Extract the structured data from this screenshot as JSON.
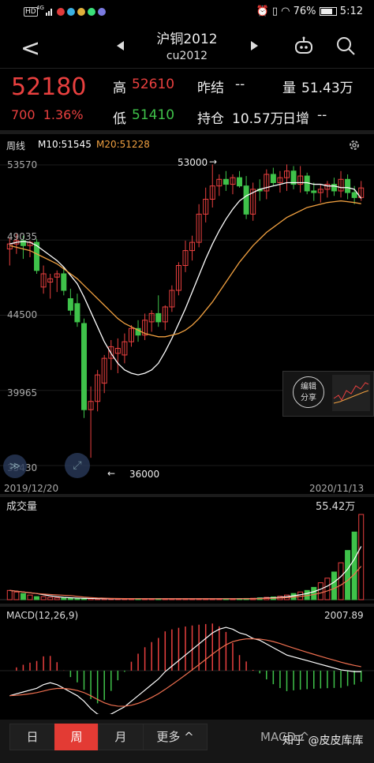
{
  "status": {
    "hd": "HD",
    "net": "4G",
    "time": "5:12",
    "battery": "76%"
  },
  "header": {
    "title": "沪铜2012",
    "subtitle": "cu2012"
  },
  "quote": {
    "price": "52180",
    "change": "700",
    "change_pct": "1.36%",
    "high_label": "高",
    "high": "52610",
    "low_label": "低",
    "low": "51410",
    "prev_settle_label": "昨结",
    "prev_settle": "--",
    "volume_label": "量",
    "volume": "51.43万",
    "open_interest_label": "持仓",
    "open_interest": "10.57万",
    "daily_add_label": "日增",
    "daily_add": "--"
  },
  "main_chart": {
    "period_label": "周线",
    "m10_label": "M10:51545",
    "m20_label": "M20:51228",
    "y_ticks": [
      "53570",
      "49035",
      "44500",
      "39965",
      "35430"
    ],
    "start_date": "2019/12/20",
    "end_date": "2020/11/13",
    "annotation_high": "53000",
    "annotation_low": "36000",
    "share_label_1": "编辑",
    "share_label_2": "分享"
  },
  "volume_chart": {
    "title": "成交量",
    "max": "55.42万"
  },
  "macd_chart": {
    "title": "MACD(12,26,9)",
    "max": "2007.89"
  },
  "tabs": [
    {
      "label": "日"
    },
    {
      "label": "周"
    },
    {
      "label": "月"
    },
    {
      "label": "更多"
    }
  ],
  "macd_button": "MACD",
  "watermark": "知乎 @皮皮库库",
  "colors": {
    "up": "#e9403f",
    "down": "#3fc24a",
    "m10": "#ffffff",
    "m20": "#f0a040"
  },
  "chart_data": {
    "type": "candlestick",
    "candles": [
      [
        48500,
        49200,
        47500,
        48800
      ],
      [
        48800,
        49400,
        48200,
        49000
      ],
      [
        49000,
        49300,
        47900,
        48700
      ],
      [
        48700,
        49000,
        48000,
        48900
      ],
      [
        48900,
        49100,
        47000,
        47200
      ],
      [
        46200,
        47500,
        45800,
        47000
      ],
      [
        46500,
        47000,
        45500,
        46700
      ],
      [
        46800,
        47200,
        45900,
        47000
      ],
      [
        47000,
        47400,
        45700,
        46000
      ],
      [
        45500,
        46100,
        44500,
        44800
      ],
      [
        45200,
        45800,
        43800,
        44100
      ],
      [
        44000,
        44300,
        38300,
        38800
      ],
      [
        38800,
        40200,
        35900,
        39300
      ],
      [
        39300,
        41200,
        38700,
        40900
      ],
      [
        40400,
        42100,
        39800,
        41900
      ],
      [
        41900,
        43000,
        41200,
        42600
      ],
      [
        42200,
        43100,
        41000,
        42500
      ],
      [
        42100,
        43400,
        41600,
        42900
      ],
      [
        42900,
        43900,
        42600,
        43700
      ],
      [
        43700,
        44200,
        42900,
        43300
      ],
      [
        43300,
        44600,
        43000,
        44200
      ],
      [
        44100,
        44800,
        43500,
        44600
      ],
      [
        44600,
        45700,
        43800,
        44100
      ],
      [
        44100,
        45100,
        43600,
        45000
      ],
      [
        45000,
        46300,
        44700,
        46000
      ],
      [
        46000,
        47700,
        45700,
        47500
      ],
      [
        47500,
        49000,
        47100,
        48400
      ],
      [
        48400,
        49300,
        47800,
        48900
      ],
      [
        48900,
        51200,
        48600,
        50600
      ],
      [
        50600,
        52200,
        50100,
        51500
      ],
      [
        51500,
        53600,
        51000,
        52300
      ],
      [
        52300,
        53000,
        51700,
        52700
      ],
      [
        52700,
        53200,
        52000,
        52400
      ],
      [
        52400,
        53000,
        51800,
        52800
      ],
      [
        52800,
        53200,
        52200,
        52300
      ],
      [
        52300,
        52900,
        50300,
        50600
      ],
      [
        50600,
        52500,
        50200,
        52100
      ],
      [
        52100,
        52700,
        51400,
        52000
      ],
      [
        52000,
        53300,
        51500,
        53000
      ],
      [
        53000,
        53400,
        52300,
        52500
      ],
      [
        52500,
        53200,
        51900,
        52800
      ],
      [
        52800,
        53600,
        52000,
        53200
      ],
      [
        53200,
        53500,
        52100,
        52400
      ],
      [
        52400,
        53500,
        51900,
        52900
      ],
      [
        52900,
        53100,
        51800,
        52000
      ],
      [
        52000,
        52500,
        51400,
        51900
      ],
      [
        51900,
        52400,
        51300,
        52100
      ],
      [
        52100,
        52600,
        51600,
        52400
      ],
      [
        52400,
        52800,
        51700,
        52000
      ],
      [
        52000,
        53200,
        51600,
        52700
      ],
      [
        52700,
        53000,
        51500,
        51900
      ],
      [
        51900,
        52300,
        51200,
        51600
      ],
      [
        51600,
        52600,
        51400,
        52180
      ]
    ],
    "ylim": [
      35430,
      53570
    ],
    "m10": [
      48800,
      48900,
      48950,
      48900,
      48700,
      48400,
      48100,
      47800,
      47400,
      46900,
      46400,
      45600,
      44700,
      43800,
      42900,
      42200,
      41600,
      41200,
      41000,
      40900,
      41000,
      41200,
      41600,
      42300,
      43100,
      44000,
      44900,
      45900,
      46900,
      47900,
      48800,
      49600,
      50300,
      50900,
      51400,
      51700,
      51900,
      52100,
      52200,
      52300,
      52400,
      52500,
      52500,
      52500,
      52500,
      52400,
      52400,
      52300,
      52300,
      52200,
      52200,
      52100,
      51545
    ],
    "m20": [
      48700,
      48600,
      48500,
      48400,
      48200,
      48000,
      47800,
      47600,
      47300,
      47000,
      46700,
      46300,
      45900,
      45500,
      45100,
      44700,
      44300,
      44000,
      43800,
      43600,
      43400,
      43300,
      43200,
      43200,
      43300,
      43400,
      43600,
      43900,
      44300,
      44800,
      45300,
      45900,
      46500,
      47100,
      47700,
      48200,
      48700,
      49100,
      49500,
      49800,
      50100,
      50400,
      50600,
      50800,
      51000,
      51100,
      51200,
      51300,
      51350,
      51400,
      51350,
      51300,
      51228
    ],
    "volume": [
      6,
      5,
      4,
      3,
      2,
      2,
      1.5,
      1.2,
      1,
      0.8,
      0.8,
      0.7,
      0.7,
      0.6,
      0.6,
      0.6,
      0.6,
      0.6,
      0.6,
      0.6,
      0.6,
      0.6,
      0.6,
      0.6,
      0.6,
      0.6,
      0.6,
      0.6,
      0.6,
      0.6,
      0.6,
      0.6,
      0.6,
      0.6,
      0.7,
      0.8,
      0.9,
      1.2,
      1.5,
      1.8,
      2.2,
      3,
      4,
      5,
      6,
      8,
      11,
      14,
      18,
      24,
      32,
      44,
      55.42
    ],
    "macd": [
      -1.2,
      -1.1,
      -1.0,
      -0.9,
      -0.8,
      -0.6,
      -0.5,
      -0.6,
      -0.8,
      -1.0,
      -1.2,
      -1.5,
      -1.9,
      -2.2,
      -2.3,
      -2.2,
      -2.0,
      -1.8,
      -1.5,
      -1.2,
      -0.9,
      -0.6,
      -0.3,
      0.1,
      0.4,
      0.7,
      1.0,
      1.3,
      1.6,
      1.9,
      2.2,
      2.4,
      2.5,
      2.4,
      2.2,
      2.1,
      1.9,
      1.8,
      1.6,
      1.4,
      1.2,
      1.0,
      0.9,
      0.8,
      0.7,
      0.6,
      0.5,
      0.4,
      0.3,
      0.2,
      0.15,
      0.1,
      0.1
    ]
  }
}
